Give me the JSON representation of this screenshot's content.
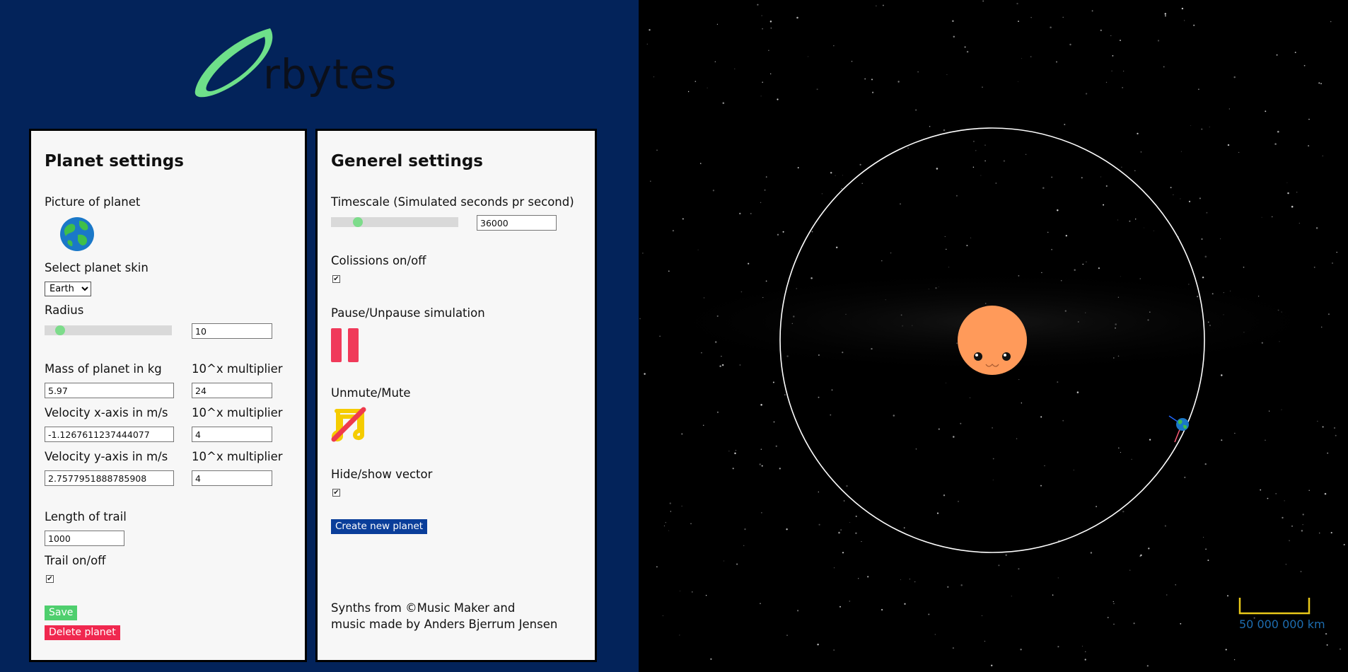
{
  "logo": {
    "text": "rbytes",
    "ring_color": "#6ee08a"
  },
  "planet_settings": {
    "title": "Planet settings",
    "picture_label": "Picture of planet",
    "skin_label": "Select planet skin",
    "skin_selected": "Earth",
    "radius_label": "Radius",
    "radius_value": "10",
    "mass_label": "Mass of planet in kg",
    "multiplier_label": "10^x multiplier",
    "mass_value": "5.97",
    "mass_multiplier": "24",
    "vx_label": "Velocity x-axis in m/s",
    "vx_value": "-1.1267611237444077",
    "vx_multiplier": "4",
    "vy_label": "Velocity y-axis in m/s",
    "vy_value": "2.7577951888785908",
    "vy_multiplier": "4",
    "trail_length_label": "Length of trail",
    "trail_length_value": "1000",
    "trail_toggle_label": "Trail on/off",
    "trail_on": true,
    "save_label": "Save",
    "delete_label": "Delete planet"
  },
  "general_settings": {
    "title": "Generel settings",
    "timescale_label": "Timescale (Simulated seconds pr second)",
    "timescale_value": "36000",
    "collisions_label": "Colissions on/off",
    "collisions_on": true,
    "pause_label": "Pause/Unpause simulation",
    "mute_label": "Unmute/Mute",
    "vector_label": "Hide/show vector",
    "vector_on": true,
    "create_label": "Create new planet",
    "credits_line1": "Synths from ©Music Maker and",
    "credits_line2": "music made by Anders Bjerrum Jensen"
  },
  "simulation": {
    "scale_label": "50 000 000 km",
    "sun_color": "#ff9a5a",
    "orbit_color": "#ffffff",
    "scale_bar_color": "#e8c81a"
  },
  "colors": {
    "left_bg": "#03235a",
    "save": "#4fcf6e",
    "delete": "#f0284f",
    "create": "#0a3e9a",
    "pause": "#f03a5a",
    "mute_note": "#f5cc00",
    "mute_slash": "#ef3a4d"
  }
}
